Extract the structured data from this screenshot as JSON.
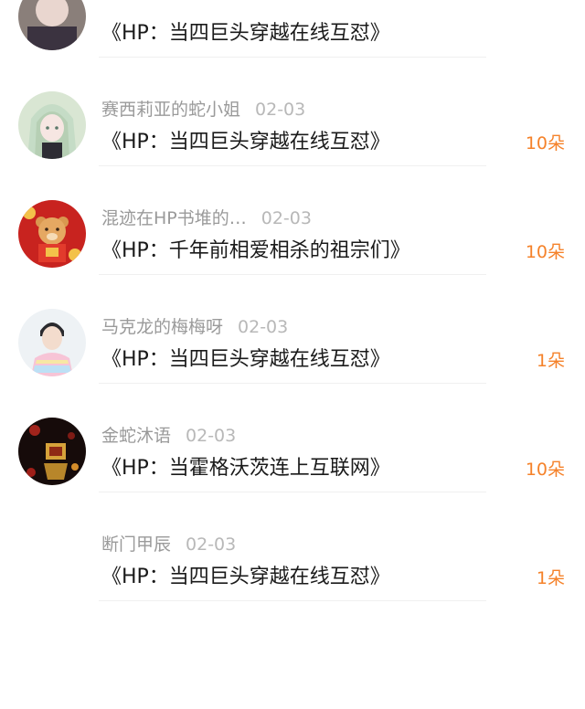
{
  "gift_list": {
    "items": [
      {
        "username": "",
        "date": "",
        "book_title": "《HP：当四巨头穿越在线互怼》",
        "count": "",
        "avatar_icon": "anime-avatar-icon"
      },
      {
        "username": "赛西莉亚的蛇小姐",
        "date": "02-03",
        "book_title": "《HP：当四巨头穿越在线互怼》",
        "count": "10朵",
        "avatar_icon": "anime-girl-avatar-icon"
      },
      {
        "username": "混迹在HP书堆的…",
        "date": "02-03",
        "book_title": "《HP：千年前相爱相杀的祖宗们》",
        "count": "10朵",
        "avatar_icon": "bear-avatar-icon"
      },
      {
        "username": "马克龙的梅梅呀",
        "date": "02-03",
        "book_title": "《HP：当四巨头穿越在线互怼》",
        "count": "1朵",
        "avatar_icon": "person-avatar-icon"
      },
      {
        "username": "金蛇沐语",
        "date": "02-03",
        "book_title": "《HP：当霍格沃茨连上互联网》",
        "count": "10朵",
        "avatar_icon": "lantern-avatar-icon"
      },
      {
        "username": "断门甲辰",
        "date": "02-03",
        "book_title": "《HP：当四巨头穿越在线互怼》",
        "count": "1朵",
        "avatar_icon": ""
      }
    ]
  },
  "colors": {
    "count": "#f5822a",
    "username": "#9a9a9a",
    "date": "#b8b8b8",
    "title": "#1a1a1a"
  }
}
